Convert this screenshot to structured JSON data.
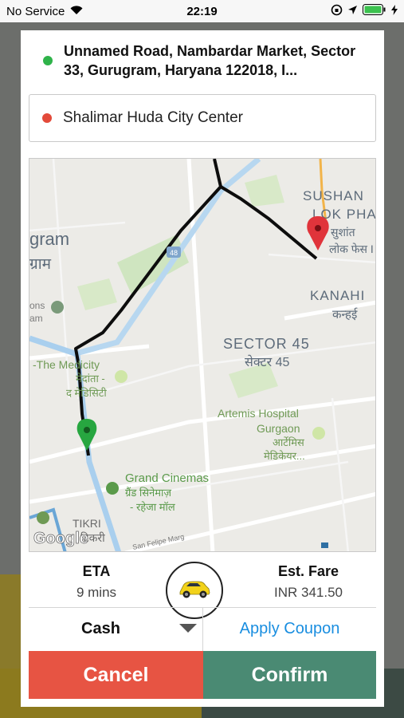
{
  "status_bar": {
    "carrier": "No Service",
    "time": "22:19"
  },
  "pickup": {
    "address": "Unnamed Road, Nambardar Market, Sector 33, Gurugram, Haryana 122018, I..."
  },
  "dropoff": {
    "address": "Shalimar Huda City Center"
  },
  "map": {
    "labels": {
      "gram": "gram",
      "gram_hi": "ग्राम",
      "sushant": "SUSHAN",
      "lok_phase": "LOK PHAS",
      "sushant_hi": "सुशांत",
      "lok_phase_hi": "लोक फेस I",
      "kanahi": "KANAHI",
      "kanahi_hi": "कन्हई",
      "sector45": "SECTOR 45",
      "sector45_hi": "सेक्टर 45",
      "medicity": "-The Medicity",
      "medicity_hi1": "मेदांता -",
      "medicity_hi2": "द मेडिसिटी",
      "artemis1": "Artemis Hospital",
      "artemis2": "Gurgaon",
      "artemis_hi1": "आर्टेमिस",
      "artemis_hi2": "मेडिकेयर...",
      "grand1": "Grand Cinemas",
      "grand_hi1": "ग्रैंड सिनेमाज़",
      "grand_hi2": "- रहेजा मॉल",
      "tikri": "TIKRI",
      "tikri_hi": "टिकरी",
      "ons": "ons",
      "am": "am",
      "felipe": "San Felipe Marg",
      "road48": "48",
      "google": "Google"
    }
  },
  "eta": {
    "label": "ETA",
    "value": "9 mins"
  },
  "fare": {
    "label": "Est. Fare",
    "value": "INR 341.50"
  },
  "payment": {
    "method": "Cash"
  },
  "coupon": {
    "label": "Apply Coupon"
  },
  "actions": {
    "cancel": "Cancel",
    "confirm": "Confirm"
  },
  "colors": {
    "pickup_dot": "#2fb34a",
    "dropoff_dot": "#e34a3a",
    "cancel": "#e75443",
    "confirm": "#4a8a73",
    "coupon": "#1a8ee0"
  }
}
